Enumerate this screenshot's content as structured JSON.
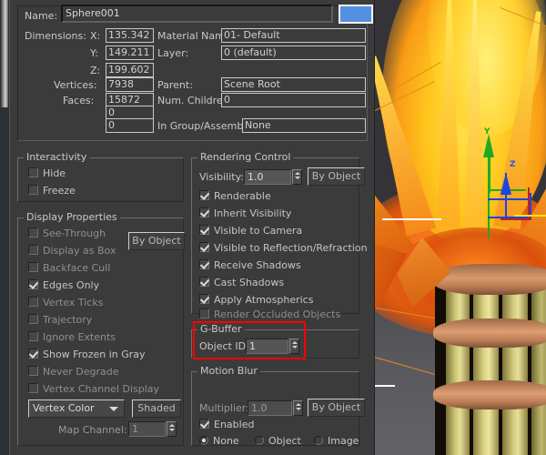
{
  "dialog": {
    "name_label": "Name:",
    "name_value": "Sphere001",
    "color_swatch": "#5590e0",
    "dimensions_label": "Dimensions:",
    "x_label": "X:",
    "x_value": "135.342",
    "y_label": "Y:",
    "y_value": "149.211",
    "z_label": "Z:",
    "z_value": "199.602",
    "vertices_label": "Vertices:",
    "vertices_value": "7938",
    "faces_label": "Faces:",
    "faces_value": "15872",
    "extra1_value": "0",
    "extra2_value": "0",
    "material_label": "Material Name:",
    "material_value": "01- Default",
    "layer_label": "Layer:",
    "layer_value": "0 (default)",
    "parent_label": "Parent:",
    "parent_value": "Scene Root",
    "children_label": "Num. Children:",
    "children_value": "0",
    "group_label": "In Group/Assembly:",
    "group_value": "None"
  },
  "interactivity": {
    "title": "Interactivity",
    "items": [
      {
        "label": "Hide",
        "checked": false
      },
      {
        "label": "Freeze",
        "checked": false
      }
    ]
  },
  "display_properties": {
    "title": "Display Properties",
    "by_object_label": "By Object",
    "items": [
      {
        "label": "See-Through",
        "checked": false
      },
      {
        "label": "Display as Box",
        "checked": false
      },
      {
        "label": "Backface Cull",
        "checked": false
      },
      {
        "label": "Edges Only",
        "checked": true
      },
      {
        "label": "Vertex Ticks",
        "checked": false
      },
      {
        "label": "Trajectory",
        "checked": false
      },
      {
        "label": "Ignore Extents",
        "checked": false
      },
      {
        "label": "Show Frozen in Gray",
        "checked": true
      },
      {
        "label": "Never Degrade",
        "checked": false
      },
      {
        "label": "Vertex Channel Display",
        "checked": false
      }
    ],
    "vertex_channel_value": "Vertex Color",
    "shaded_label": "Shaded",
    "map_channel_label": "Map Channel:",
    "map_channel_value": "1"
  },
  "rendering_control": {
    "title": "Rendering Control",
    "visibility_label": "Visibility:",
    "visibility_value": "1.0",
    "by_object_label": "By Object",
    "items": [
      {
        "label": "Renderable",
        "checked": true
      },
      {
        "label": "Inherit Visibility",
        "checked": true
      },
      {
        "label": "Visible to Camera",
        "checked": true
      },
      {
        "label": "Visible to Reflection/Refraction",
        "checked": true
      },
      {
        "label": "Receive Shadows",
        "checked": true
      },
      {
        "label": "Cast Shadows",
        "checked": true
      },
      {
        "label": "Apply Atmospherics",
        "checked": true
      },
      {
        "label": "Render Occluded Objects",
        "checked": false
      }
    ]
  },
  "g_buffer": {
    "title": "G-Buffer",
    "object_id_label": "Object ID:",
    "object_id_value": "1",
    "highlight_color": "#ff0000"
  },
  "motion_blur": {
    "title": "Motion Blur",
    "multiplier_label": "Multiplier:",
    "multiplier_value": "1.0",
    "by_object_label": "By Object",
    "enabled_label": "Enabled",
    "enabled_checked": true,
    "options": [
      {
        "label": "None",
        "selected": true
      },
      {
        "label": "Object",
        "selected": false
      },
      {
        "label": "Image",
        "selected": false
      }
    ]
  },
  "viewport": {
    "gizmo_y_label": "Y",
    "gizmo_z_label": "Z"
  }
}
